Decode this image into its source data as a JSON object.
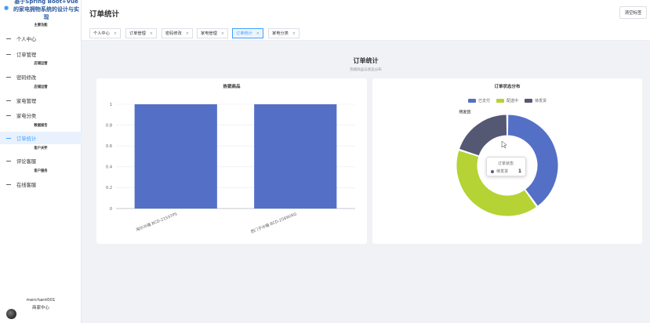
{
  "app": {
    "title": "基于Spring Boot+Vue的家电拥物系统的设计与实现"
  },
  "sidebar": {
    "items": [
      {
        "label": "个人中心",
        "sub": "主要功能",
        "active": false
      },
      {
        "label": "订单管理",
        "sub": "店铺运营",
        "active": false
      },
      {
        "label": "密码修改",
        "sub": "店铺运营",
        "active": false
      },
      {
        "label": "家电管理",
        "sub": "",
        "active": false
      },
      {
        "label": "家电分类",
        "sub": "数据报告",
        "active": false
      },
      {
        "label": "订单统计",
        "sub": "客户关怀",
        "active": true
      },
      {
        "label": "评论客服",
        "sub": "客户服务",
        "active": false
      },
      {
        "label": "在线客服",
        "sub": "",
        "active": false
      }
    ],
    "user": {
      "name": "merchant001",
      "role": "商家中心"
    }
  },
  "header": {
    "title": "订单统计",
    "clear_label": "清空标签"
  },
  "tabs": [
    {
      "label": "个人中心",
      "close": "×",
      "active": false
    },
    {
      "label": "订单管理",
      "close": "×",
      "active": false
    },
    {
      "label": "密码修改",
      "close": "×",
      "active": false
    },
    {
      "label": "家电管理",
      "close": "×",
      "active": false
    },
    {
      "label": "订单统计",
      "close": "×",
      "active": true
    },
    {
      "label": "家电分类",
      "close": "×",
      "active": false
    }
  ],
  "main": {
    "title": "订单统计",
    "subtitle": "热销商品与状态分布"
  },
  "chart_data": [
    {
      "type": "bar",
      "title": "热销商品",
      "categories": [
        "海尔冰箱 BCD-215STPS",
        "西门子冰箱 BCD-258W(KG"
      ],
      "values": [
        1,
        1
      ],
      "ylim": [
        0,
        1
      ],
      "yticks": [
        "0",
        "0.2",
        "0.4",
        "0.6",
        "0.8",
        "1"
      ],
      "grid": true,
      "color": "#5470c6"
    },
    {
      "type": "pie",
      "title": "订单状态分布",
      "legend_position": "top",
      "slices": [
        {
          "name": "已支付",
          "value": 1,
          "color": "#5470c6"
        },
        {
          "name": "配送中",
          "value": 1,
          "color": "#b5d334"
        },
        {
          "name": "待发货",
          "value": 0.5,
          "color": "#555873"
        }
      ],
      "highlight_label": "待发货",
      "tooltip": {
        "title": "订单状态",
        "name": "待发货",
        "value": "1"
      }
    }
  ]
}
